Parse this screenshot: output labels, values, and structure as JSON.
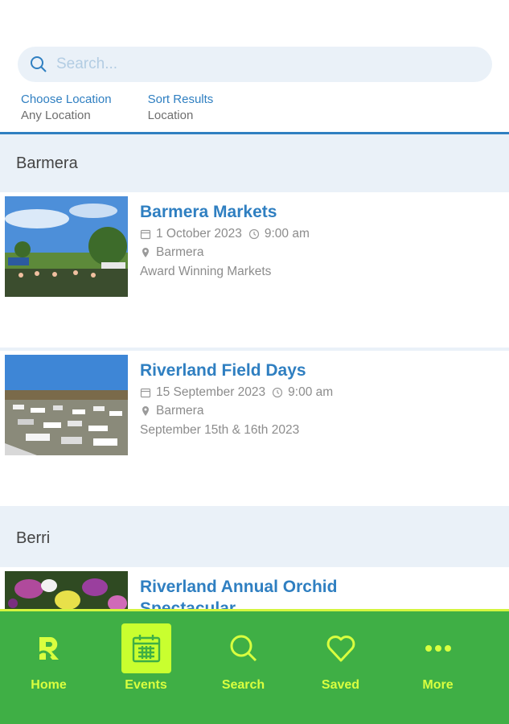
{
  "search": {
    "placeholder": "Search..."
  },
  "filters": {
    "location_label": "Choose Location",
    "location_value": "Any Location",
    "sort_label": "Sort Results",
    "sort_value": "Location"
  },
  "sections": [
    {
      "name": "Barmera",
      "events": [
        {
          "title": "Barmera Markets",
          "date": "1 October 2023",
          "time": "9:00 am",
          "location": "Barmera",
          "description": "Award Winning Markets"
        },
        {
          "title": "Riverland Field Days",
          "date": "15 September 2023",
          "time": "9:00 am",
          "location": "Barmera",
          "description": "September 15th & 16th 2023"
        }
      ]
    },
    {
      "name": "Berri",
      "events": [
        {
          "title": "Riverland Annual Orchid Spectacular"
        }
      ]
    }
  ],
  "nav": {
    "home": "Home",
    "events": "Events",
    "search": "Search",
    "saved": "Saved",
    "more": "More",
    "active": "events"
  },
  "colors": {
    "accent_blue": "#2f7fc1",
    "nav_green": "#3faf45",
    "nav_lime": "#d9ff3f"
  }
}
